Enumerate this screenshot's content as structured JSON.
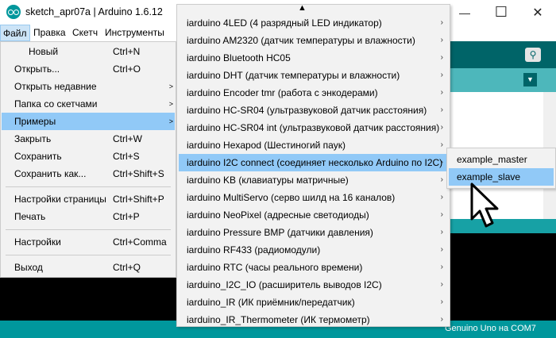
{
  "window": {
    "title": "sketch_apr07a | Arduino 1.6.12",
    "minimize": "—",
    "maximize": "☐",
    "close": "✕"
  },
  "menubar": [
    "Файл",
    "Правка",
    "Скетч",
    "Инструменты"
  ],
  "file_menu": [
    {
      "label": "Новый",
      "shortcut": "Ctrl+N"
    },
    {
      "label": "Открыть...",
      "shortcut": "Ctrl+O"
    },
    {
      "label": "Открыть недавние",
      "shortcut": ""
    },
    {
      "label": "Папка со скетчами",
      "shortcut": ""
    },
    {
      "label": "Примеры",
      "shortcut": ""
    },
    {
      "label": "Закрыть",
      "shortcut": "Ctrl+W"
    },
    {
      "label": "Сохранить",
      "shortcut": "Ctrl+S"
    },
    {
      "label": "Сохранить как...",
      "shortcut": "Ctrl+Shift+S"
    },
    {
      "label": "Настройки страницы",
      "shortcut": "Ctrl+Shift+P"
    },
    {
      "label": "Печать",
      "shortcut": "Ctrl+P"
    },
    {
      "label": "Настройки",
      "shortcut": "Ctrl+Comma"
    },
    {
      "label": "Выход",
      "shortcut": "Ctrl+Q"
    }
  ],
  "examples_menu": [
    "iarduino 4LED (4 разрядный LED индикатор)",
    "iarduino AM2320 (датчик температуры и влажности)",
    "iarduino Bluetooth HC05",
    "iarduino DHT (датчик температуры и влажности)",
    "iarduino Encoder tmr (работа с энкодерами)",
    "iarduino HC-SR04 (ультразвуковой датчик расстояния)",
    "iarduino HC-SR04 int (ультразвуковой датчик расстояния)",
    "iarduino Hexapod (Шестиногий паук)",
    "iarduino I2C connect (соединяет несколько Arduino по I2C)",
    "iarduino KB (клавиатуры матричные)",
    "iarduino MultiServo (серво шилд на 16 каналов)",
    "iarduino NeoPixel (адресные светодиоды)",
    "iarduino Pressure BMP (датчики давления)",
    "iarduino RF433 (радиомодули)",
    "iarduino RTC (часы реального времени)",
    "iarduino_I2C_IO (расширитель выводов I2C)",
    "iarduino_IR (ИК приёмник/передатчик)",
    "iarduino_IR_Thermometer (ИК термометр)"
  ],
  "sub_menu": [
    "example_master",
    "example_slave"
  ],
  "status": {
    "board": "Genuino Uno на COM7"
  },
  "icons": {
    "scroll_up": "▲",
    "submenu_arrow": "›",
    "search": "⚲",
    "dropdown": "▼"
  },
  "colors": {
    "teal_dark": "#006468",
    "teal": "#00979c",
    "highlight": "#91c9f7"
  }
}
